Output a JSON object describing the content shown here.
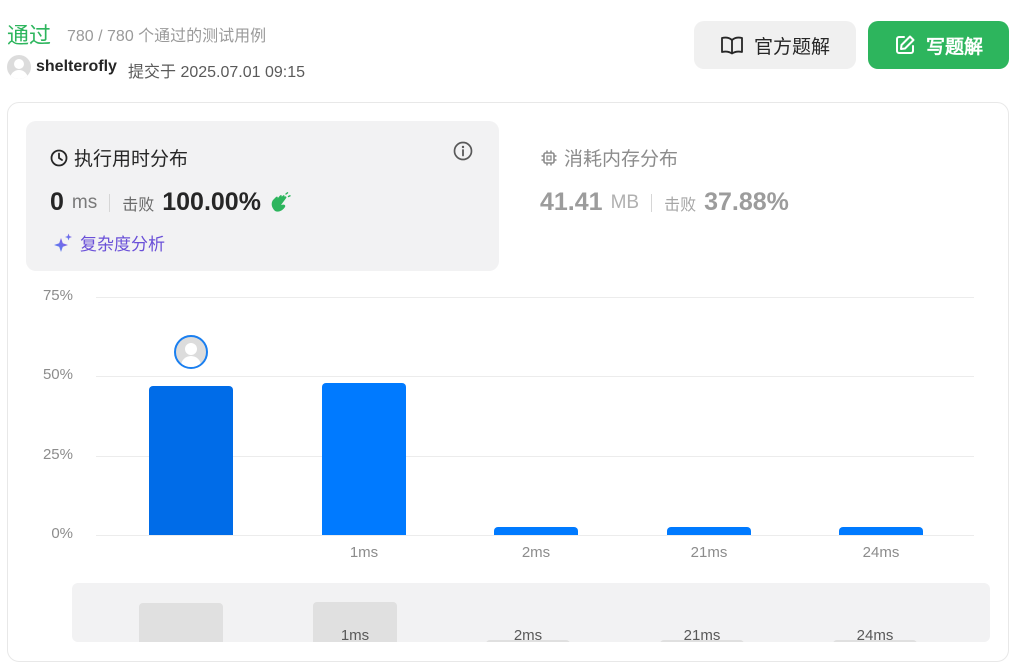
{
  "header": {
    "status": "通过",
    "cases": "780 / 780 个通过的测试用例",
    "username": "shelterofly",
    "submitted": "提交于 2025.07.01 09:15",
    "official_solution_label": "官方题解",
    "write_solution_label": "写题解"
  },
  "runtime": {
    "title": "执行用时分布",
    "value": "0",
    "unit": "ms",
    "beat_label": "击败",
    "beat_value": "100.00%",
    "complexity_label": "复杂度分析"
  },
  "memory": {
    "title": "消耗内存分布",
    "value": "41.41",
    "unit": "MB",
    "beat_label": "击败",
    "beat_value": "37.88%"
  },
  "colors": {
    "accent_green": "#2db55d",
    "bar_selected": "#006ce8",
    "bar": "#007aff",
    "complexity_purple": "#6a50d8"
  },
  "chart_data": {
    "type": "bar",
    "categories": [
      "",
      "1ms",
      "2ms",
      "21ms",
      "24ms"
    ],
    "values": [
      47,
      48,
      2,
      2,
      2
    ],
    "selected_index": 0,
    "yticks": [
      "75%",
      "50%",
      "25%",
      "0%"
    ],
    "ylim": [
      0,
      75
    ],
    "grid": true
  },
  "minimap": {
    "labels": [
      "",
      "1ms",
      "2ms",
      "21ms",
      "24ms"
    ]
  }
}
